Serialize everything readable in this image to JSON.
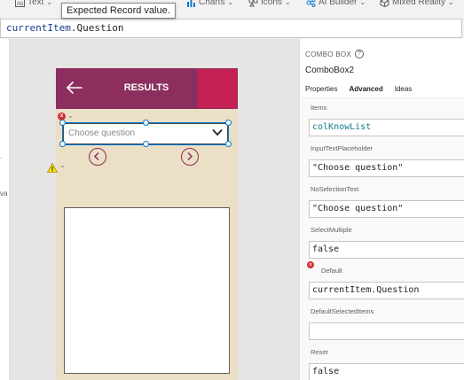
{
  "ribbon": {
    "items": [
      {
        "label": "Text",
        "icon": "text-icon"
      },
      {
        "label": "Charts",
        "icon": "charts-icon"
      },
      {
        "label": "Icons",
        "icon": "icons-icon"
      },
      {
        "label": "AI Builder",
        "icon": "ai-builder-icon"
      },
      {
        "label": "Mixed Reality",
        "icon": "mixed-reality-icon"
      }
    ]
  },
  "tooltip": {
    "text": "Expected Record value."
  },
  "formula": {
    "object": "currentItem",
    "dot": ".",
    "property": "Question"
  },
  "left_strip": {
    "mark1": ".",
    "mark2": "va"
  },
  "app_screen": {
    "title": "RESULTS",
    "header_color": "#8c2f5e",
    "accent_color": "#c42054",
    "combo_placeholder": "Choose question",
    "error_badge": "x"
  },
  "panel": {
    "control_type": "COMBO BOX",
    "help_glyph": "?",
    "control_name": "ComboBox2",
    "tabs": [
      {
        "label": "Properties",
        "active": false
      },
      {
        "label": "Advanced",
        "active": true
      },
      {
        "label": "Ideas",
        "active": false
      }
    ],
    "props": [
      {
        "label": "Items",
        "value": "colKnowList",
        "teal": true
      },
      {
        "label": "InputTextPlaceholder",
        "value": "\"Choose question\""
      },
      {
        "label": "NoSelectionText",
        "value": "\"Choose question\""
      },
      {
        "label": "SelectMultiple",
        "value": "false"
      },
      {
        "label": "Default",
        "value": "currentItem.Question",
        "error": "x"
      },
      {
        "label": "DefaultSelectedItems",
        "value": ""
      },
      {
        "label": "Reset",
        "value": "false"
      }
    ]
  }
}
